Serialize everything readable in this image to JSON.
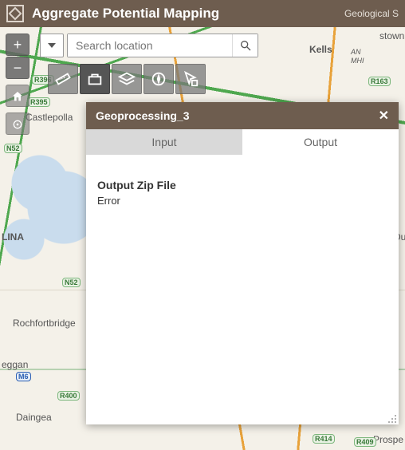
{
  "header": {
    "title": "Aggregate Potential Mapping",
    "subtitle": "Geological S"
  },
  "search": {
    "placeholder": "Search location"
  },
  "map_controls": {
    "zoom_in": "+",
    "zoom_out": "−"
  },
  "map_labels": {
    "kells": "Kells",
    "castlepolla": "Castlepolla",
    "lina": "LINA",
    "rochfortbridge": "Rochfortbridge",
    "eggan": "eggan",
    "daingea": "Daingea",
    "stown": "stown",
    "du": "Du",
    "prospe": "Prospe",
    "an": "AN",
    "mhi": "MHI"
  },
  "road_shields": {
    "n52a": "N52",
    "n52b": "N52",
    "m6": "M6",
    "r163": "R163",
    "r414": "R414",
    "r409": "R409",
    "r395": "R395",
    "r396": "R396",
    "r400": "R400"
  },
  "dialog": {
    "title": "Geoprocessing_3",
    "tabs": {
      "input": "Input",
      "output": "Output"
    },
    "active_tab": "output",
    "output": {
      "label": "Output Zip File",
      "value": "Error"
    }
  }
}
